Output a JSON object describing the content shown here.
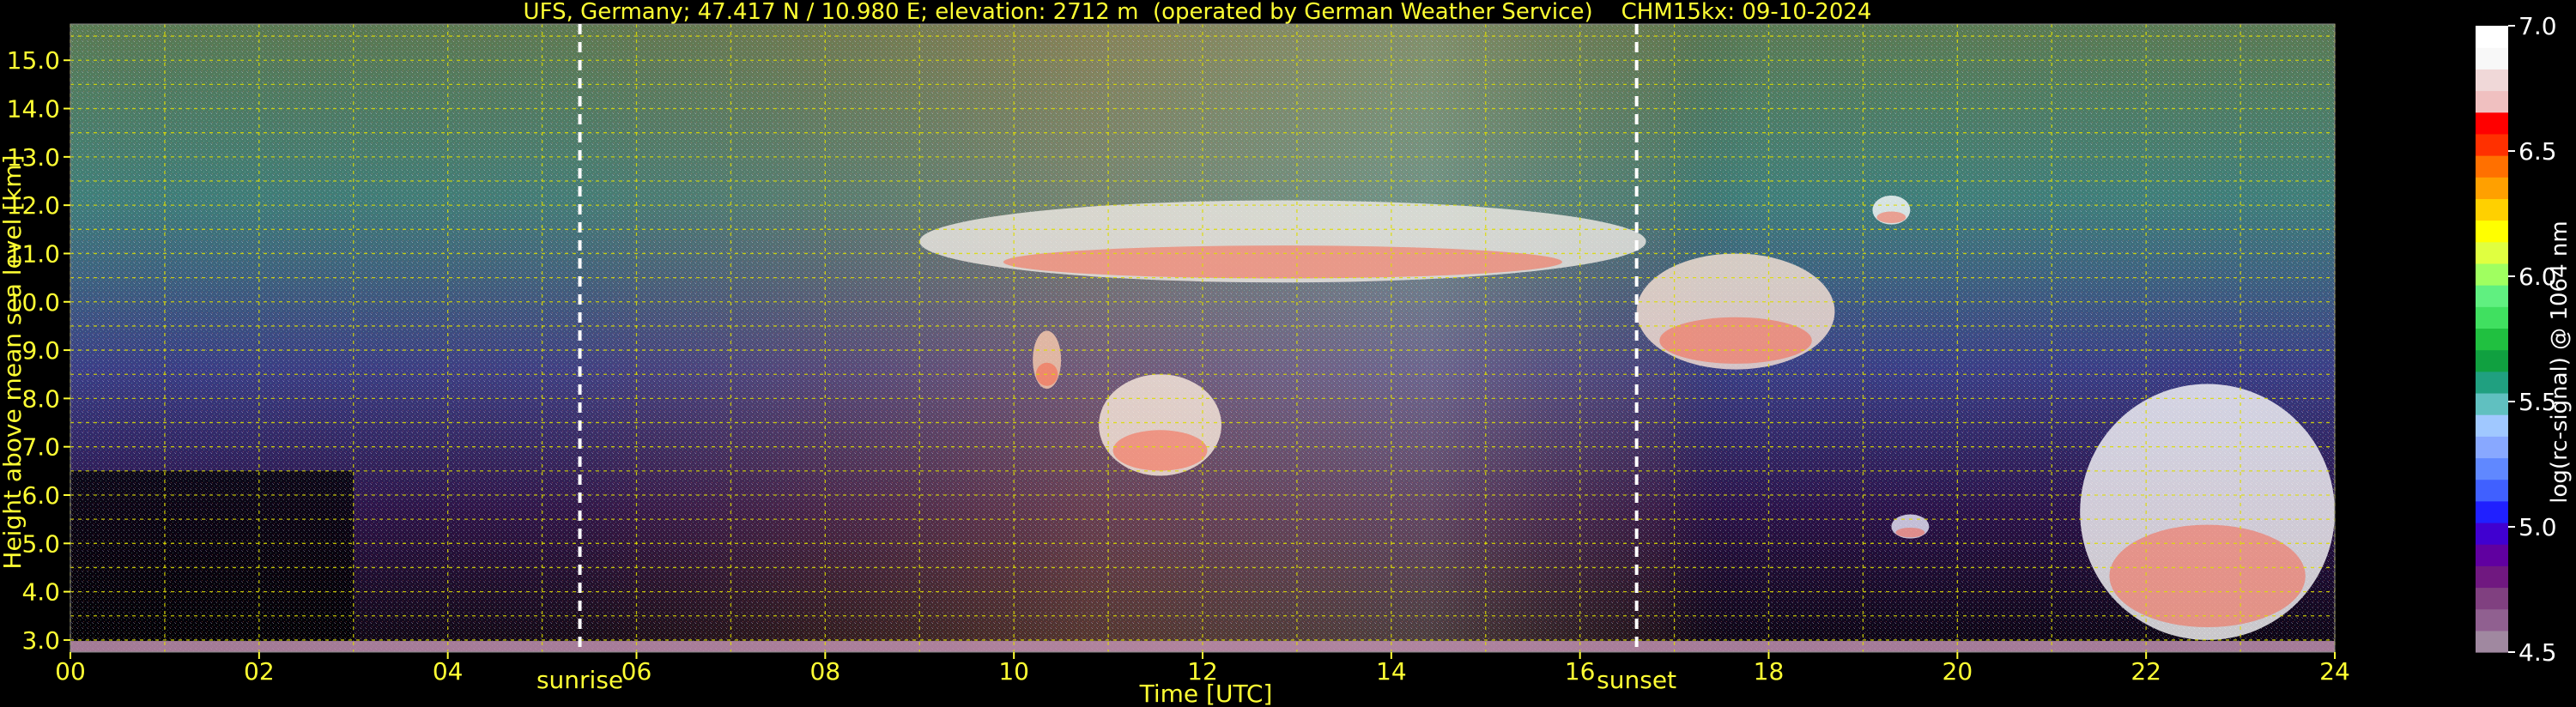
{
  "chart_data": {
    "type": "heatmap",
    "title": "UFS, Germany; 47.417 N / 10.980 E; elevation: 2712 m  (operated by German Weather Service)    CHM15kx: 09-10-2024",
    "xlabel": "Time [UTC]",
    "ylabel": "Height above mean sea level [km]",
    "xlim": [
      0,
      24
    ],
    "ylim": [
      2.75,
      15.75
    ],
    "x_ticks": [
      "00",
      "02",
      "04",
      "06",
      "08",
      "10",
      "12",
      "14",
      "16",
      "18",
      "20",
      "22",
      "24"
    ],
    "y_ticks": [
      "3.0",
      "4.0",
      "5.0",
      "6.0",
      "7.0",
      "8.0",
      "9.0",
      "10.0",
      "11.0",
      "12.0",
      "13.0",
      "14.0",
      "15.0"
    ],
    "grid": true,
    "colorbar": {
      "label": "log(rc-signal) @ 1064 nm",
      "range": [
        4.5,
        7.0
      ],
      "ticks": [
        "4.5",
        "5.0",
        "5.5",
        "6.0",
        "6.5",
        "7.0"
      ]
    },
    "events": [
      {
        "label": "sunrise",
        "time": 5.4
      },
      {
        "label": "sunset",
        "time": 16.6
      }
    ],
    "cloud_layers": [
      {
        "start": 9.0,
        "end": 16.7,
        "base": 10.4,
        "top": 12.1
      },
      {
        "start": 16.6,
        "end": 18.7,
        "base": 8.6,
        "top": 11.0
      },
      {
        "start": 19.1,
        "end": 19.5,
        "base": 11.6,
        "top": 12.2
      },
      {
        "start": 10.2,
        "end": 10.5,
        "base": 8.2,
        "top": 9.4
      },
      {
        "start": 10.9,
        "end": 12.2,
        "base": 6.4,
        "top": 8.5
      },
      {
        "start": 19.3,
        "end": 19.7,
        "base": 5.1,
        "top": 5.6
      },
      {
        "start": 21.3,
        "end": 24.0,
        "base": 3.0,
        "top": 8.3
      }
    ]
  }
}
